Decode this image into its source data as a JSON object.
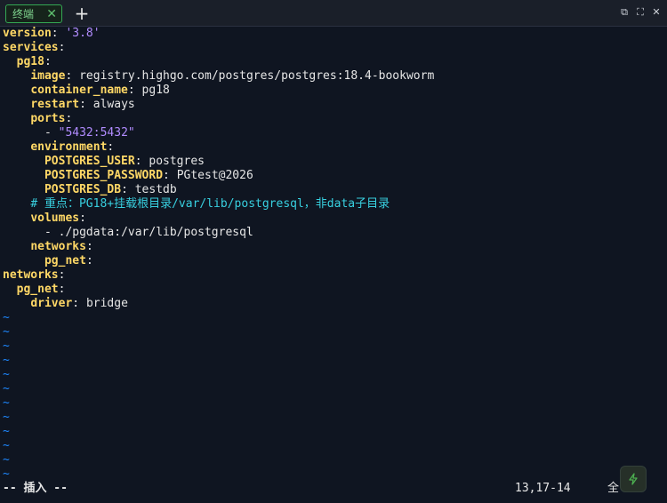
{
  "tabbar": {
    "tab_label": "终端",
    "close_glyph": "✕",
    "add_glyph": "+",
    "controls": [
      "⧉",
      "⛶",
      "✕"
    ]
  },
  "editor": {
    "lines": [
      [
        [
          "k",
          "version"
        ],
        [
          "p",
          ": "
        ],
        [
          "s",
          "'3.8'"
        ]
      ],
      [
        [
          "k",
          "services"
        ],
        [
          "p",
          ":"
        ]
      ],
      [
        [
          "p",
          "  "
        ],
        [
          "k",
          "pg18"
        ],
        [
          "p",
          ":"
        ]
      ],
      [
        [
          "p",
          "    "
        ],
        [
          "k",
          "image"
        ],
        [
          "p",
          ": "
        ],
        [
          "v",
          "registry.highgo.com/postgres/postgres:18.4-bookworm"
        ]
      ],
      [
        [
          "p",
          "    "
        ],
        [
          "k",
          "container_name"
        ],
        [
          "p",
          ": "
        ],
        [
          "v",
          "pg18"
        ]
      ],
      [
        [
          "p",
          "    "
        ],
        [
          "k",
          "restart"
        ],
        [
          "p",
          ": "
        ],
        [
          "v",
          "always"
        ]
      ],
      [
        [
          "p",
          "    "
        ],
        [
          "k",
          "ports"
        ],
        [
          "p",
          ":"
        ]
      ],
      [
        [
          "p",
          "      - "
        ],
        [
          "s",
          "\"5432:5432\""
        ]
      ],
      [
        [
          "p",
          "    "
        ],
        [
          "k",
          "environment"
        ],
        [
          "p",
          ":"
        ]
      ],
      [
        [
          "p",
          "      "
        ],
        [
          "k",
          "POSTGRES_USER"
        ],
        [
          "p",
          ": "
        ],
        [
          "v",
          "postgres"
        ]
      ],
      [
        [
          "p",
          "      "
        ],
        [
          "k",
          "POSTGRES_PASSWORD"
        ],
        [
          "p",
          ": "
        ],
        [
          "v",
          "PGtest@2026"
        ]
      ],
      [
        [
          "p",
          "      "
        ],
        [
          "k",
          "POSTGRES_DB"
        ],
        [
          "p",
          ": "
        ],
        [
          "v",
          "testdb"
        ]
      ],
      [
        [
          "p",
          "    "
        ],
        [
          "c",
          "# 重点：PG18+挂载根目录/var/lib/postgresql，非data子目录"
        ]
      ],
      [
        [
          "p",
          "    "
        ],
        [
          "k",
          "volumes"
        ],
        [
          "p",
          ":"
        ]
      ],
      [
        [
          "p",
          "      - "
        ],
        [
          "v",
          "./pgdata:/var/lib/postgresql"
        ]
      ],
      [
        [
          "p",
          "    "
        ],
        [
          "k",
          "networks"
        ],
        [
          "p",
          ":"
        ]
      ],
      [
        [
          "p",
          "      "
        ],
        [
          "k",
          "pg_net"
        ],
        [
          "p",
          ":"
        ]
      ],
      [
        [
          "k",
          "networks"
        ],
        [
          "p",
          ":"
        ]
      ],
      [
        [
          "p",
          "  "
        ],
        [
          "k",
          "pg_net"
        ],
        [
          "p",
          ":"
        ]
      ],
      [
        [
          "p",
          "    "
        ],
        [
          "k",
          "driver"
        ],
        [
          "p",
          ": "
        ],
        [
          "v",
          "bridge"
        ]
      ]
    ],
    "tilde": "~",
    "tilde_count": 12
  },
  "statusline": {
    "mode": "-- 插入 --",
    "position": "13,17-14",
    "scroll": "全"
  },
  "colors": {
    "background": "#0f1521",
    "key": "#ffd866",
    "string": "#b18cff",
    "comment": "#38d0e0",
    "tilde": "#1e88ff",
    "tab_accent": "#34a853"
  },
  "icons": {
    "fab": "lightning-icon"
  }
}
